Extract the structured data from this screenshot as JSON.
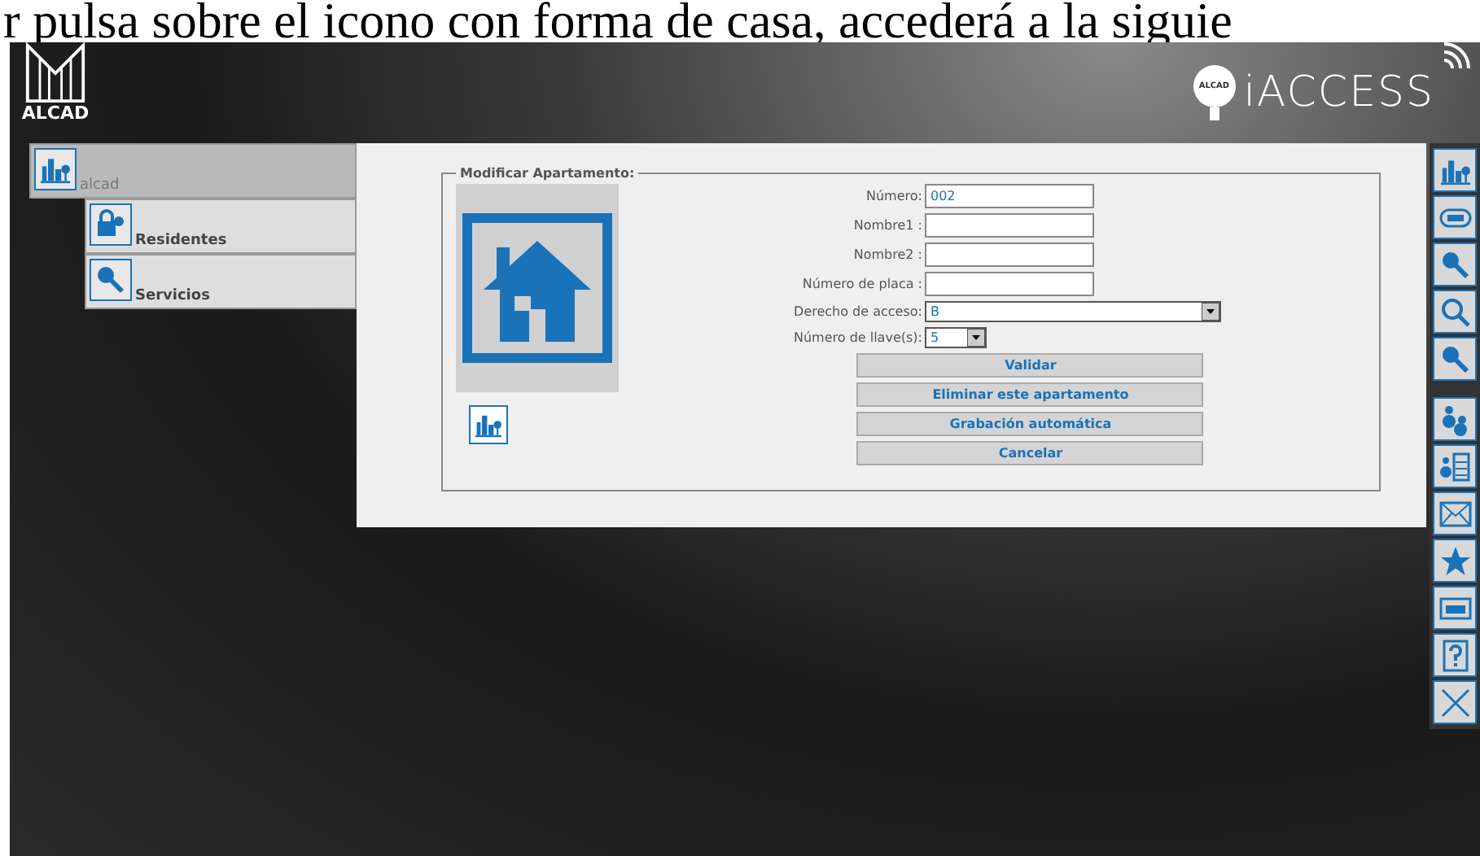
{
  "caption": "r pulsa sobre el icono con forma de casa, accederá a la siguie",
  "header": {
    "brand": "ALCAD",
    "product": "iACCESS",
    "product_badge": "ALCAD"
  },
  "tree": {
    "label": "alcad",
    "selected": true,
    "children": [
      {
        "label": "Residentes",
        "selected": false
      },
      {
        "label": "Servicios",
        "selected": false
      }
    ]
  },
  "form": {
    "legend": "Modificar Apartamento:",
    "fields": [
      {
        "kind": "text",
        "label": "Número:",
        "value": "002"
      },
      {
        "kind": "text",
        "label": "Nombre1 :"
      },
      {
        "kind": "text",
        "label": "Nombre2 :"
      },
      {
        "kind": "text",
        "label": "Número de placa :"
      },
      {
        "kind": "longselect",
        "label": "Derecho de acceso:",
        "value": "B"
      },
      {
        "kind": "shortselect",
        "label": "Número de llave(s):",
        "value": "5"
      }
    ],
    "buttons": [
      "Validar",
      "Eliminar este apartamento",
      "Grabación automática",
      "Cancelar"
    ]
  }
}
